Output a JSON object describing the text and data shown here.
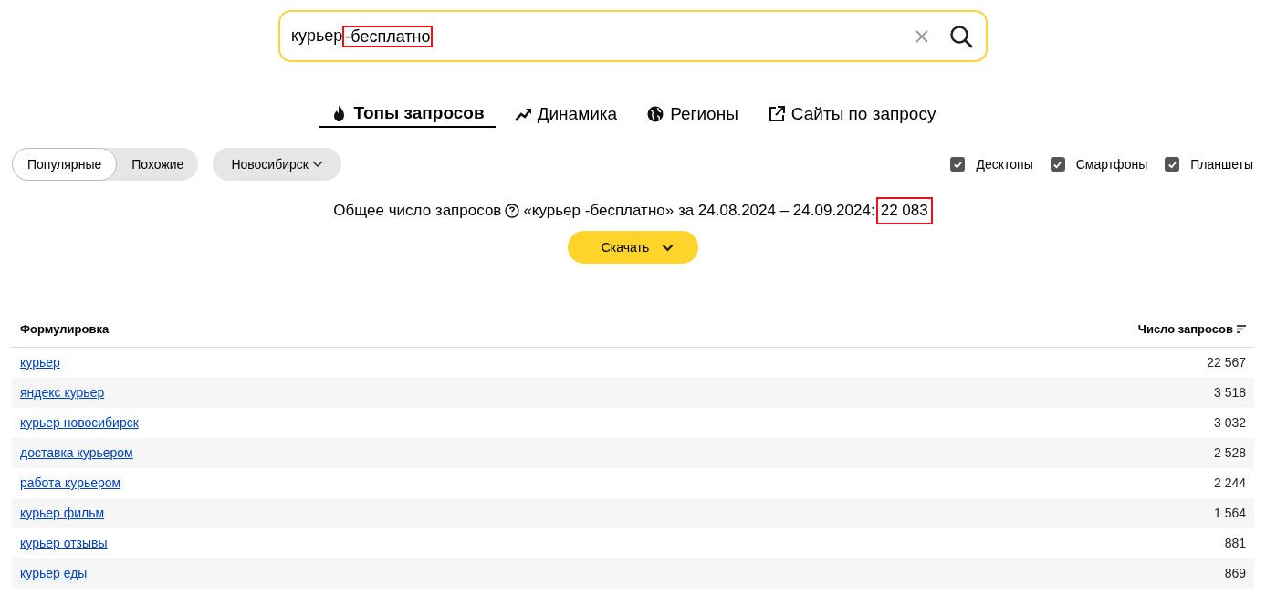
{
  "search": {
    "query_parts": [
      {
        "text": "курьер",
        "highlighted": false
      },
      {
        "text": "-бесплатно",
        "highlighted": true
      }
    ]
  },
  "tabs": [
    {
      "label": "Топы запросов",
      "kind": "fire",
      "selected": true
    },
    {
      "label": "Динамика",
      "kind": "trend",
      "selected": false
    },
    {
      "label": "Регионы",
      "kind": "globe",
      "selected": false
    },
    {
      "label": "Сайты по запросу",
      "kind": "external",
      "selected": false
    }
  ],
  "mode_toggle": [
    {
      "label": "Популярные",
      "selected": true
    },
    {
      "label": "Похожие",
      "selected": false
    }
  ],
  "region_dropdown": {
    "label": "Новосибирск"
  },
  "devices": [
    {
      "label": "Десктопы",
      "checked": true
    },
    {
      "label": "Смартфоны",
      "checked": true
    },
    {
      "label": "Планшеты",
      "checked": true
    }
  ],
  "summary": {
    "label": "Общее число запросов",
    "details": "«курьер -бесплатно» за 24.08.2024 – 24.09.2024:",
    "total": "22 083",
    "total_highlighted": true
  },
  "download_button": {
    "label": "Скачать"
  },
  "table": {
    "columns": [
      "Формулировка",
      "Число запросов"
    ],
    "rows": [
      {
        "phrase": "курьер",
        "count": "22 567"
      },
      {
        "phrase": "яндекс курьер",
        "count": "3 518"
      },
      {
        "phrase": "курьер новосибирск",
        "count": "3 032"
      },
      {
        "phrase": "доставка курьером",
        "count": "2 528"
      },
      {
        "phrase": "работа курьером",
        "count": "2 244"
      },
      {
        "phrase": "курьер фильм",
        "count": "1 564"
      },
      {
        "phrase": "курьер отзывы",
        "count": "881"
      },
      {
        "phrase": "курьер еды",
        "count": "869"
      }
    ]
  }
}
